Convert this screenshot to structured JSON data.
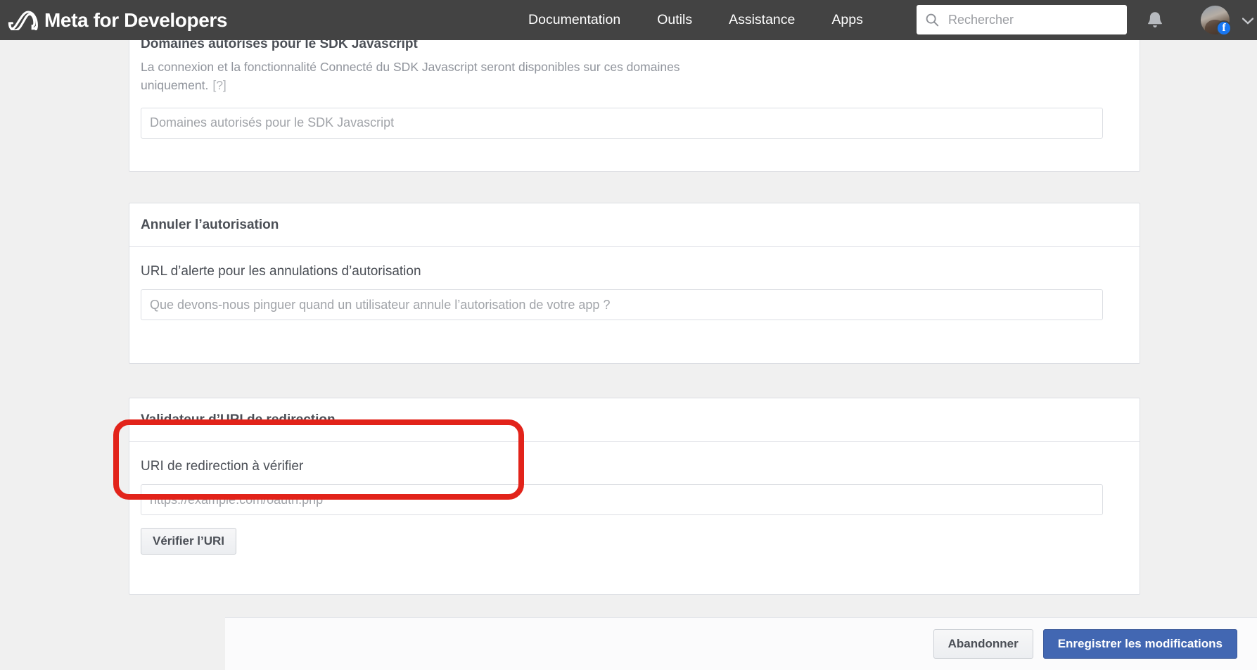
{
  "header": {
    "brand": "Meta for Developers",
    "logo_icon": "meta-infinity-logo",
    "nav": [
      {
        "label": "Documentation"
      },
      {
        "label": "Outils"
      },
      {
        "label": "Assistance"
      },
      {
        "label": "Apps"
      }
    ],
    "search": {
      "placeholder": "Rechercher",
      "value": "",
      "icon": "search-icon"
    },
    "notifications_icon": "bell-icon",
    "avatar_badge": "f",
    "caret_icon": "chevron-down-icon",
    "colors": {
      "background": "#434343",
      "text": "#ffffff"
    }
  },
  "javascript_sdk_card": {
    "title": "Domaines autorisés pour le SDK Javascript",
    "help_text": "La connexion et la fonctionnalité Connecté du SDK Javascript seront disponibles sur ces domaines uniquement.",
    "help_hint": "[?]",
    "input": {
      "placeholder": "Domaines autorisés pour le SDK Javascript",
      "value": ""
    }
  },
  "deauthorize_card": {
    "title": "Annuler l’autorisation",
    "field_label": "URL d’alerte pour les annulations d’autorisation",
    "input": {
      "placeholder": "Que devons-nous pinguer quand un utilisateur annule l’autorisation de votre app ?",
      "value": ""
    }
  },
  "redirect_uri_card": {
    "title": "Validateur d’URI de redirection",
    "field_label": "URI de redirection à vérifier",
    "input": {
      "placeholder": "https://example.com/oauth.php",
      "value": ""
    },
    "verify_button": "Vérifier l’URI"
  },
  "annotation": {
    "type": "highlight-rectangle",
    "color": "#e2231a",
    "target": "redirect-uri-field-group"
  },
  "action_bar": {
    "cancel_label": "Abandonner",
    "save_label": "Enregistrer les modifications",
    "save_color": "#4267b2"
  }
}
